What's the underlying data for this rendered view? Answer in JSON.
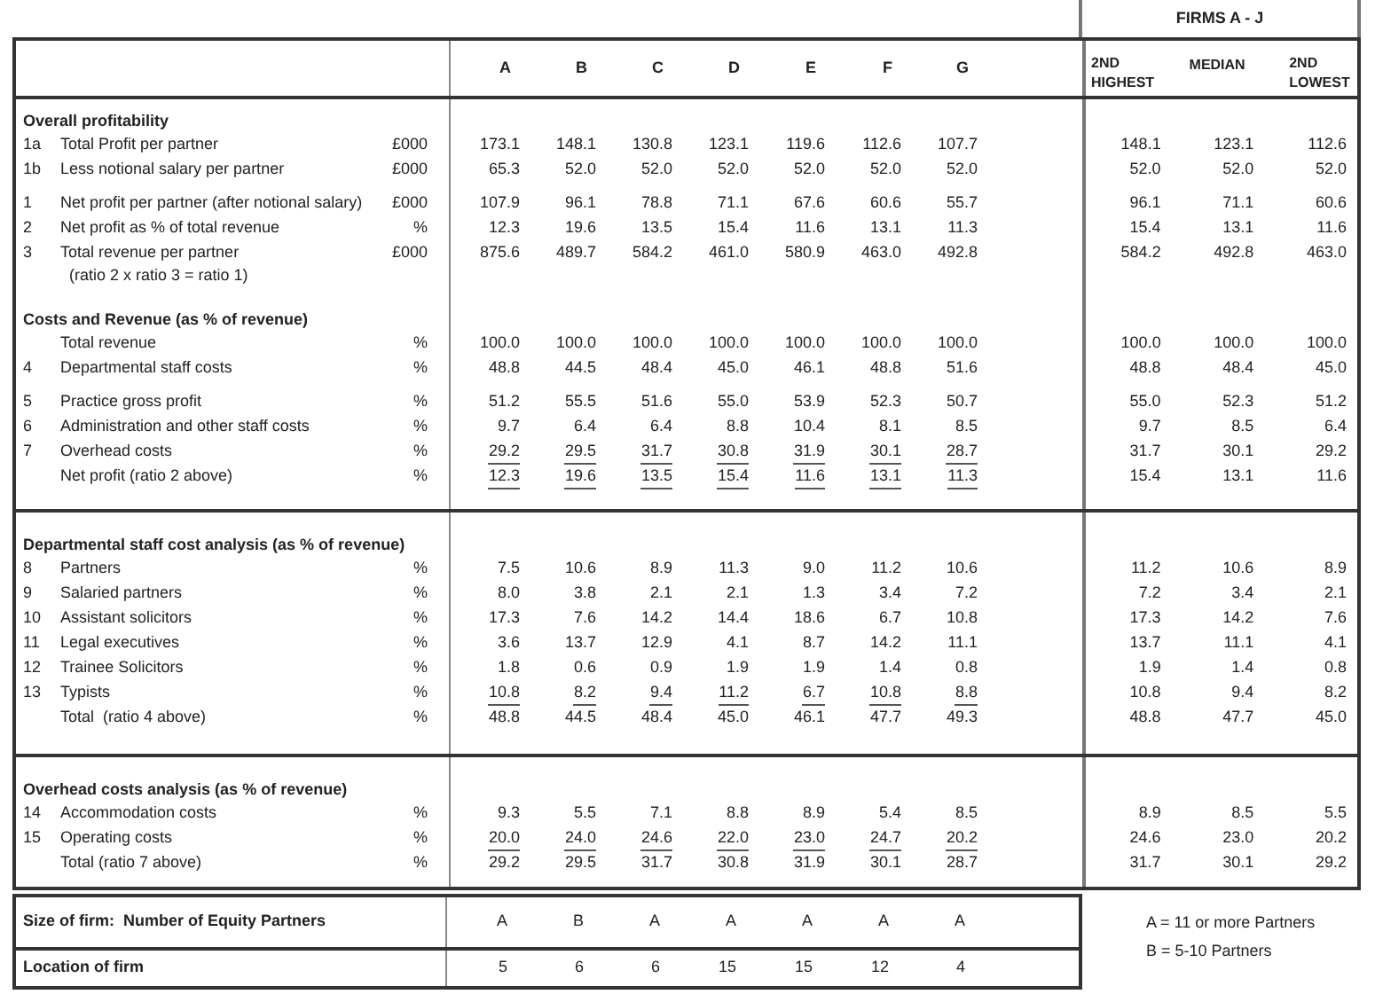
{
  "group_header": "FIRMS A - J",
  "columns": {
    "firms": [
      "A",
      "B",
      "C",
      "D",
      "E",
      "F",
      "G"
    ],
    "stats": [
      "2ND HIGHEST",
      "MEDIAN",
      "2ND LOWEST"
    ]
  },
  "boxes": [
    {
      "sections": [
        {
          "heading": "Overall profitability",
          "groups": [
            [
              {
                "number": "1a",
                "label": "Total Profit per partner",
                "unit": "£000",
                "values": [
                  "173.1",
                  "148.1",
                  "130.8",
                  "123.1",
                  "119.6",
                  "112.6",
                  "107.7"
                ],
                "stats": [
                  "148.1",
                  "123.1",
                  "112.6"
                ],
                "underlined": false
              },
              {
                "number": "1b",
                "label": "Less notional salary per partner",
                "unit": "£000",
                "values": [
                  "65.3",
                  "52.0",
                  "52.0",
                  "52.0",
                  "52.0",
                  "52.0",
                  "52.0"
                ],
                "stats": [
                  "52.0",
                  "52.0",
                  "52.0"
                ],
                "underlined": false
              }
            ],
            [
              {
                "number": "1",
                "label": "Net profit per partner (after notional salary)",
                "unit": "£000",
                "values": [
                  "107.9",
                  "96.1",
                  "78.8",
                  "71.1",
                  "67.6",
                  "60.6",
                  "55.7"
                ],
                "stats": [
                  "96.1",
                  "71.1",
                  "60.6"
                ],
                "underlined": false
              },
              {
                "number": "2",
                "label": "Net profit as % of total revenue",
                "unit": "%",
                "values": [
                  "12.3",
                  "19.6",
                  "13.5",
                  "15.4",
                  "11.6",
                  "13.1",
                  "11.3"
                ],
                "stats": [
                  "15.4",
                  "13.1",
                  "11.6"
                ],
                "underlined": false
              },
              {
                "number": "3",
                "label": "Total revenue per partner",
                "note": "(ratio 2 x ratio 3 = ratio 1)",
                "unit": "£000",
                "values": [
                  "875.6",
                  "489.7",
                  "584.2",
                  "461.0",
                  "580.9",
                  "463.0",
                  "492.8"
                ],
                "stats": [
                  "584.2",
                  "492.8",
                  "463.0"
                ],
                "underlined": false
              }
            ]
          ]
        },
        {
          "heading": "Costs and Revenue (as % of revenue)",
          "groups": [
            [
              {
                "label": "Total revenue",
                "unit": "%",
                "values": [
                  "100.0",
                  "100.0",
                  "100.0",
                  "100.0",
                  "100.0",
                  "100.0",
                  "100.0"
                ],
                "stats": [
                  "100.0",
                  "100.0",
                  "100.0"
                ],
                "underlined": false
              },
              {
                "number": "4",
                "label": "Departmental staff costs",
                "unit": "%",
                "values": [
                  "48.8",
                  "44.5",
                  "48.4",
                  "45.0",
                  "46.1",
                  "48.8",
                  "51.6"
                ],
                "stats": [
                  "48.8",
                  "48.4",
                  "45.0"
                ],
                "underlined": false
              }
            ],
            [
              {
                "number": "5",
                "label": "Practice gross profit",
                "unit": "%",
                "values": [
                  "51.2",
                  "55.5",
                  "51.6",
                  "55.0",
                  "53.9",
                  "52.3",
                  "50.7"
                ],
                "stats": [
                  "55.0",
                  "52.3",
                  "51.2"
                ],
                "underlined": false
              },
              {
                "number": "6",
                "label": "Administration and other staff costs",
                "unit": "%",
                "values": [
                  "9.7",
                  "6.4",
                  "6.4",
                  "8.8",
                  "10.4",
                  "8.1",
                  "8.5"
                ],
                "stats": [
                  "9.7",
                  "8.5",
                  "6.4"
                ],
                "underlined": false
              },
              {
                "number": "7",
                "label": "Overhead costs",
                "unit": "%",
                "values": [
                  "29.2",
                  "29.5",
                  "31.7",
                  "30.8",
                  "31.9",
                  "30.1",
                  "28.7"
                ],
                "stats": [
                  "31.7",
                  "30.1",
                  "29.2"
                ],
                "underlined": true
              },
              {
                "label": "Net profit (ratio 2 above)",
                "unit": "%",
                "values": [
                  "12.3",
                  "19.6",
                  "13.5",
                  "15.4",
                  "11.6",
                  "13.1",
                  "11.3"
                ],
                "stats": [
                  "15.4",
                  "13.1",
                  "11.6"
                ],
                "underlined": true
              }
            ]
          ]
        }
      ]
    },
    {
      "sections": [
        {
          "heading": "Departmental staff cost analysis (as % of revenue)",
          "groups": [
            [
              {
                "number": "8",
                "label": "Partners",
                "unit": "%",
                "values": [
                  "7.5",
                  "10.6",
                  "8.9",
                  "11.3",
                  "9.0",
                  "11.2",
                  "10.6"
                ],
                "stats": [
                  "11.2",
                  "10.6",
                  "8.9"
                ],
                "underlined": false
              },
              {
                "number": "9",
                "label": "Salaried partners",
                "unit": "%",
                "values": [
                  "8.0",
                  "3.8",
                  "2.1",
                  "2.1",
                  "1.3",
                  "3.4",
                  "7.2"
                ],
                "stats": [
                  "7.2",
                  "3.4",
                  "2.1"
                ],
                "underlined": false
              },
              {
                "number": "10",
                "label": "Assistant solicitors",
                "unit": "%",
                "values": [
                  "17.3",
                  "7.6",
                  "14.2",
                  "14.4",
                  "18.6",
                  "6.7",
                  "10.8"
                ],
                "stats": [
                  "17.3",
                  "14.2",
                  "7.6"
                ],
                "underlined": false
              },
              {
                "number": "11",
                "label": "Legal executives",
                "unit": "%",
                "values": [
                  "3.6",
                  "13.7",
                  "12.9",
                  "4.1",
                  "8.7",
                  "14.2",
                  "11.1"
                ],
                "stats": [
                  "13.7",
                  "11.1",
                  "4.1"
                ],
                "underlined": false
              },
              {
                "number": "12",
                "label": "Trainee Solicitors",
                "unit": "%",
                "values": [
                  "1.8",
                  "0.6",
                  "0.9",
                  "1.9",
                  "1.9",
                  "1.4",
                  "0.8"
                ],
                "stats": [
                  "1.9",
                  "1.4",
                  "0.8"
                ],
                "underlined": false
              },
              {
                "number": "13",
                "label": "Typists",
                "unit": "%",
                "values": [
                  "10.8",
                  "8.2",
                  "9.4",
                  "11.2",
                  "6.7",
                  "10.8",
                  "8.8"
                ],
                "stats": [
                  "10.8",
                  "9.4",
                  "8.2"
                ],
                "underlined": true
              },
              {
                "label": "Total  (ratio 4 above)",
                "unit": "%",
                "values": [
                  "48.8",
                  "44.5",
                  "48.4",
                  "45.0",
                  "46.1",
                  "47.7",
                  "49.3"
                ],
                "stats": [
                  "48.8",
                  "47.7",
                  "45.0"
                ],
                "underlined": false
              }
            ]
          ]
        }
      ]
    },
    {
      "sections": [
        {
          "heading": "Overhead costs analysis (as % of revenue)",
          "groups": [
            [
              {
                "number": "14",
                "label": "Accommodation costs",
                "unit": "%",
                "values": [
                  "9.3",
                  "5.5",
                  "7.1",
                  "8.8",
                  "8.9",
                  "5.4",
                  "8.5"
                ],
                "stats": [
                  "8.9",
                  "8.5",
                  "5.5"
                ],
                "underlined": false
              },
              {
                "number": "15",
                "label": "Operating costs",
                "unit": "%",
                "values": [
                  "20.0",
                  "24.0",
                  "24.6",
                  "22.0",
                  "23.0",
                  "24.7",
                  "20.2"
                ],
                "stats": [
                  "24.6",
                  "23.0",
                  "20.2"
                ],
                "underlined": true
              },
              {
                "label": "Total (ratio 7 above)",
                "unit": "%",
                "values": [
                  "29.2",
                  "29.5",
                  "31.7",
                  "30.8",
                  "31.9",
                  "30.1",
                  "28.7"
                ],
                "stats": [
                  "31.7",
                  "30.1",
                  "29.2"
                ],
                "underlined": false
              }
            ]
          ]
        }
      ]
    }
  ],
  "firm_details": [
    {
      "label": "Size of firm:  Number of Equity Partners",
      "values": [
        "A",
        "B",
        "A",
        "A",
        "A",
        "A",
        "A"
      ]
    },
    {
      "label": "Location of firm",
      "values": [
        "5",
        "6",
        "6",
        "15",
        "15",
        "12",
        "4"
      ]
    }
  ],
  "legend": [
    "A = 11 or more Partners",
    "B = 5-10 Partners"
  ]
}
